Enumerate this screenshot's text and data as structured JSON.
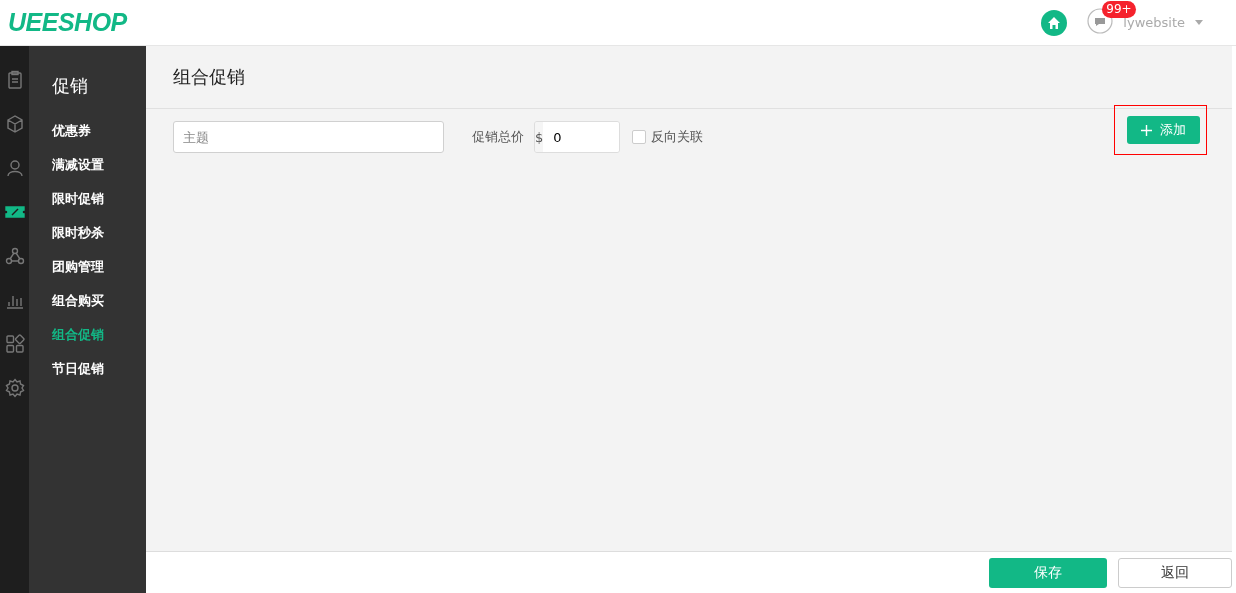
{
  "header": {
    "logo": "UEESHOP",
    "notification_count": "99+",
    "username": "lywebsite"
  },
  "rail": [
    {
      "kind": "clipboard",
      "selected": false
    },
    {
      "kind": "box",
      "selected": false
    },
    {
      "kind": "user",
      "selected": false
    },
    {
      "kind": "ticket",
      "selected": true
    },
    {
      "kind": "network",
      "selected": false
    },
    {
      "kind": "chart",
      "selected": false
    },
    {
      "kind": "apps",
      "selected": false
    },
    {
      "kind": "gear",
      "selected": false
    }
  ],
  "sidebar": {
    "title": "促销",
    "items": [
      {
        "label": "优惠券",
        "selected": false
      },
      {
        "label": "满减设置",
        "selected": false
      },
      {
        "label": "限时促销",
        "selected": false
      },
      {
        "label": "限时秒杀",
        "selected": false
      },
      {
        "label": "团购管理",
        "selected": false
      },
      {
        "label": "组合购买",
        "selected": false
      },
      {
        "label": "组合促销",
        "selected": true
      },
      {
        "label": "节日促销",
        "selected": false
      }
    ]
  },
  "page_title": "组合促销",
  "form": {
    "subject_placeholder": "主题",
    "price_label": "促销总价",
    "currency": "$",
    "price_value": "0",
    "reverse_label": "反向关联",
    "reverse_checked": false,
    "add_button": "添加",
    "add_highlighted": true
  },
  "footer": {
    "save": "保存",
    "back": "返回"
  }
}
